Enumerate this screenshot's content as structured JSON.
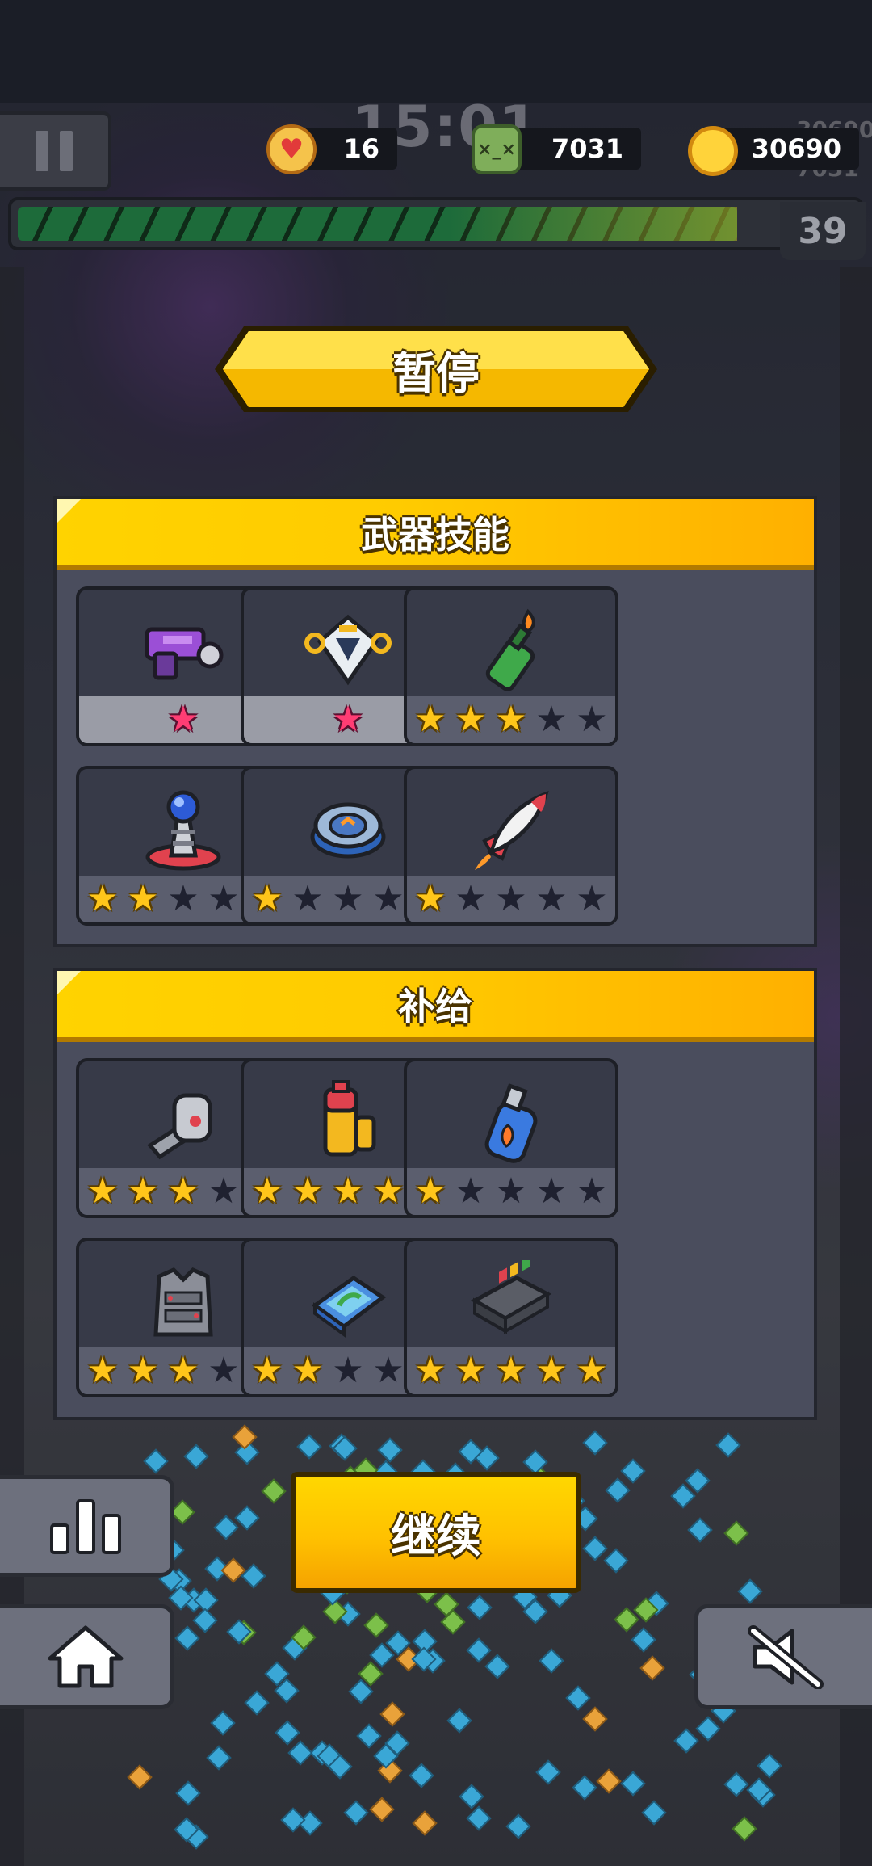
{
  "hud": {
    "clock": "15:01",
    "lives": "16",
    "kills": "7031",
    "coins": "30690",
    "ghost_coins": "30690",
    "ghost_kills": "7031",
    "level": "39",
    "xp_progress": 0.86
  },
  "pause_title": "暂停",
  "weapons": {
    "title": "武器技能",
    "items": [
      {
        "icon": "purple-blaster-icon",
        "stars": 1,
        "max": 1
      },
      {
        "icon": "drone-icon",
        "stars": 1,
        "max": 1
      },
      {
        "icon": "molotov-bottle-icon",
        "stars": 3,
        "max": 5
      },
      {
        "icon": "tesla-coil-icon",
        "stars": 2,
        "max": 5
      },
      {
        "icon": "guardian-disc-icon",
        "stars": 1,
        "max": 5
      },
      {
        "icon": "rocket-icon",
        "stars": 1,
        "max": 5
      }
    ]
  },
  "supplies": {
    "title": "补给",
    "items": [
      {
        "icon": "robot-arm-icon",
        "stars": 3,
        "max": 5
      },
      {
        "icon": "battery-cell-icon",
        "stars": 4,
        "max": 5
      },
      {
        "icon": "potion-bottle-icon",
        "stars": 1,
        "max": 5
      },
      {
        "icon": "armor-vest-icon",
        "stars": 3,
        "max": 5
      },
      {
        "icon": "map-book-icon",
        "stars": 2,
        "max": 5
      },
      {
        "icon": "energy-module-icon",
        "stars": 5,
        "max": 5
      }
    ]
  },
  "buttons": {
    "continue": "继续"
  },
  "colors": {
    "accent_yellow": "#ffc61a",
    "panel_bg": "#4a4d5d",
    "card_bg": "#373a48",
    "pink_star": "#ff3d74"
  }
}
